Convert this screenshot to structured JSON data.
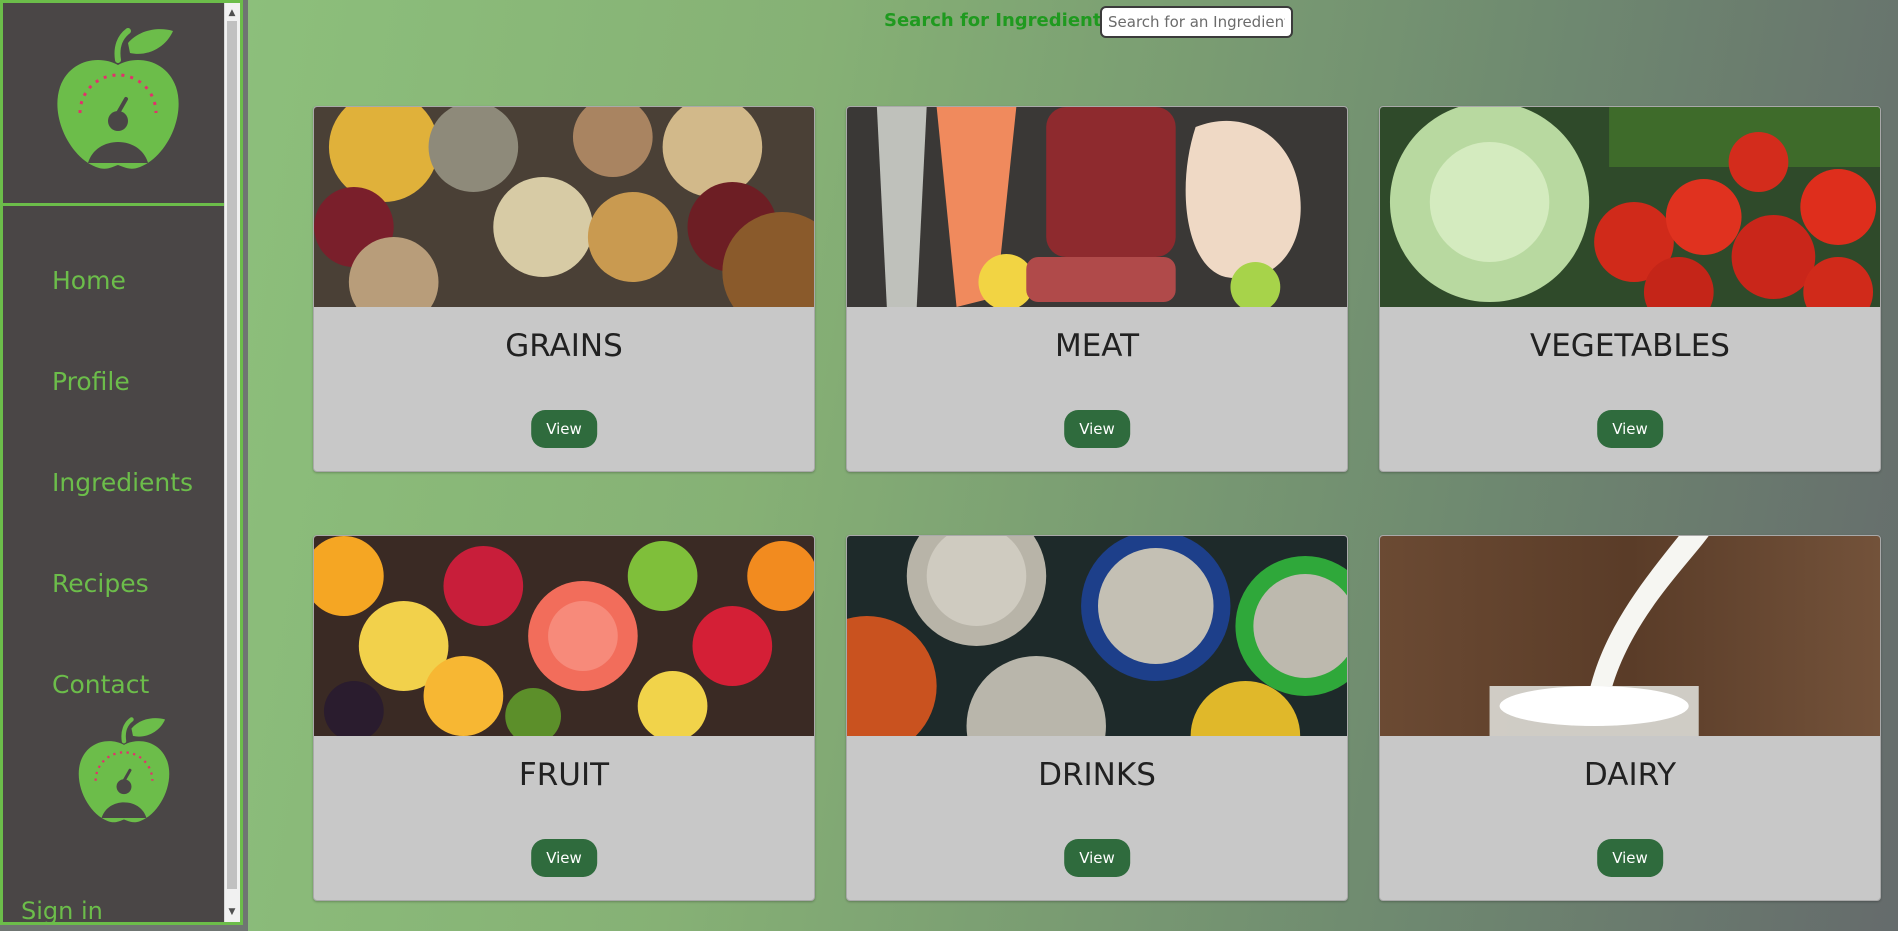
{
  "sidebar": {
    "nav": [
      {
        "label": "Home"
      },
      {
        "label": "Profile"
      },
      {
        "label": "Ingredients"
      },
      {
        "label": "Recipes"
      },
      {
        "label": "Contact"
      }
    ],
    "sign_in": "Sign in",
    "logo_icon": "apple-scale-icon",
    "scroll_up": "▲",
    "scroll_down": "▼"
  },
  "search": {
    "label": "Search for Ingredients:",
    "placeholder": "Search for an Ingredient",
    "value": ""
  },
  "categories": [
    {
      "title": "GRAINS",
      "button": "View",
      "image_icon": "grains-photo"
    },
    {
      "title": "MEAT",
      "button": "View",
      "image_icon": "meat-photo"
    },
    {
      "title": "VEGETABLES",
      "button": "View",
      "image_icon": "vegetables-photo"
    },
    {
      "title": "FRUIT",
      "button": "View",
      "image_icon": "fruit-photo"
    },
    {
      "title": "DRINKS",
      "button": "View",
      "image_icon": "drinks-photo"
    },
    {
      "title": "DAIRY",
      "button": "View",
      "image_icon": "dairy-photo"
    }
  ],
  "colors": {
    "accent": "#6cbd4a",
    "sidebar_bg": "#4a4646",
    "button_bg": "#2f6b3d",
    "search_label": "#1f9a1f"
  }
}
